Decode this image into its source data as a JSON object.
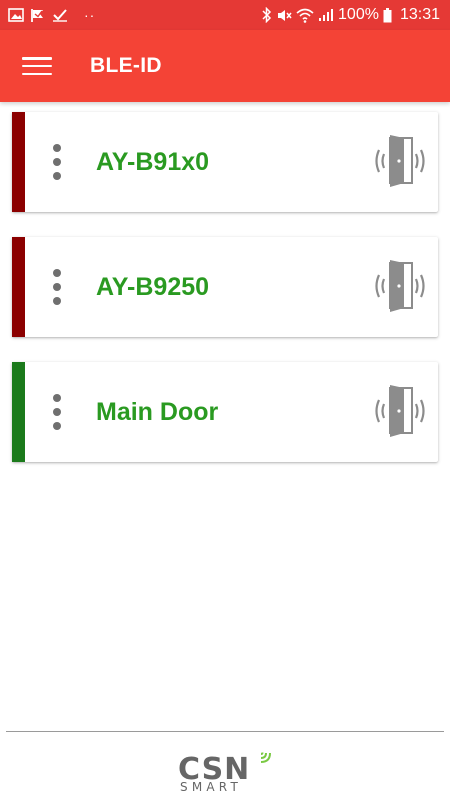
{
  "status_bar": {
    "left_icons": [
      "image-icon",
      "flag-icon",
      "check-icon"
    ],
    "dots": "··",
    "right_icons": [
      "bluetooth-icon",
      "mute-icon",
      "wifi-icon",
      "signal-icon"
    ],
    "battery": "100%",
    "time": "13:31",
    "color": "#e53935"
  },
  "app_bar": {
    "title": "BLE-ID",
    "color": "#f44336"
  },
  "devices": [
    {
      "name": "AY-B91x0",
      "stripe_color": "#8b0000"
    },
    {
      "name": "AY-B9250",
      "stripe_color": "#8b0000"
    },
    {
      "name": "Main Door",
      "stripe_color": "#1b7a1b"
    }
  ],
  "name_color": "#2a9a21",
  "footer": {
    "logo_main": "CSN",
    "logo_sub": "SMART",
    "accent_color": "#7ac943"
  }
}
